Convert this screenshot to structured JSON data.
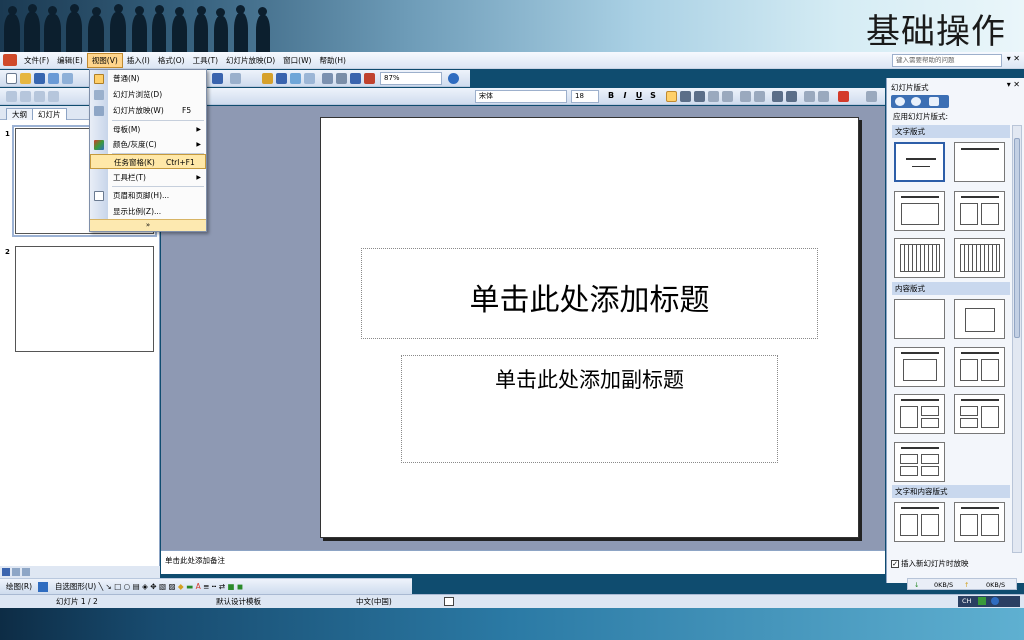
{
  "banner": {
    "title": "基础操作"
  },
  "menubar": {
    "items": [
      "文件(F)",
      "编辑(E)",
      "视图(V)",
      "插入(I)",
      "格式(O)",
      "工具(T)",
      "幻灯片放映(D)",
      "窗口(W)",
      "帮助(H)"
    ],
    "active_index": 2,
    "help_placeholder": "键入需要帮助的问题"
  },
  "toolbar": {
    "zoom": "87%",
    "font_name": "宋体",
    "font_size": "18",
    "bold": "B",
    "italic": "I",
    "underline": "U",
    "shadow": "S"
  },
  "view_menu": {
    "items": [
      {
        "label": "普通(N)",
        "shortcut": "",
        "submenu": false
      },
      {
        "label": "幻灯片浏览(D)",
        "shortcut": "",
        "submenu": false
      },
      {
        "label": "幻灯片放映(W)",
        "shortcut": "F5",
        "submenu": false
      },
      {
        "label": "母板(M)",
        "shortcut": "",
        "submenu": true
      },
      {
        "label": "颜色/灰度(C)",
        "shortcut": "",
        "submenu": true
      },
      {
        "label": "任务窗格(K)",
        "shortcut": "Ctrl+F1",
        "submenu": false
      },
      {
        "label": "工具栏(T)",
        "shortcut": "",
        "submenu": true
      },
      {
        "label": "页眉和页脚(H)...",
        "shortcut": "",
        "submenu": false
      },
      {
        "label": "显示比例(Z)...",
        "shortcut": "",
        "submenu": false
      }
    ],
    "highlighted_index": 5,
    "expand": "»"
  },
  "left_panel": {
    "tabs": [
      "大纲",
      "幻灯片"
    ],
    "active_tab": 1,
    "thumbnails": [
      "1",
      "2"
    ]
  },
  "slide": {
    "title_placeholder": "单击此处添加标题",
    "subtitle_placeholder": "单击此处添加副标题"
  },
  "notes": {
    "placeholder": "单击此处添加备注"
  },
  "taskpane": {
    "title": "幻灯片版式",
    "apply_label": "应用幻灯片版式:",
    "sections": [
      "文字版式",
      "内容版式",
      "文字和内容版式"
    ],
    "show_on_insert": "插入新幻灯片时放映",
    "net_down": "0KB/S",
    "net_up": "0KB/S"
  },
  "drawbar": {
    "draw_label": "绘图(R)",
    "autoshape_label": "自选图形(U)"
  },
  "status": {
    "slide_info": "幻灯片 1 / 2",
    "template": "默认设计模板",
    "language": "中文(中国)"
  },
  "tray": {
    "ime": "CH"
  },
  "colors": {
    "accent": "#3c6fb4",
    "menu_highlight": "#ffe8a8",
    "workspace": "#8e99b3"
  }
}
